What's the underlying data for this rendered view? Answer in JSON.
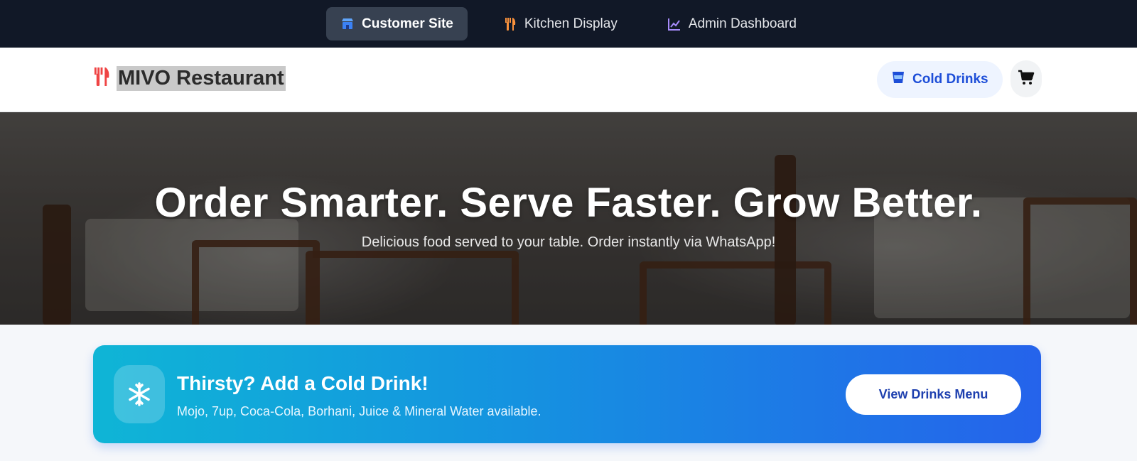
{
  "topbar": {
    "items": [
      {
        "label": "Customer Site",
        "icon": "store-icon",
        "active": true
      },
      {
        "label": "Kitchen Display",
        "icon": "utensils-icon",
        "active": false
      },
      {
        "label": "Admin Dashboard",
        "icon": "chart-line-icon",
        "active": false
      }
    ]
  },
  "header": {
    "brand_icon": "utensils-icon",
    "brand_title": "MIVO Restaurant",
    "drinks_label": "Cold Drinks",
    "drinks_icon": "glass-icon",
    "cart_icon": "cart-icon"
  },
  "hero": {
    "headline": "Order Smarter. Serve Faster. Grow Better.",
    "subtitle": "Delicious food served to your table. Order instantly via WhatsApp!"
  },
  "promo": {
    "icon": "snowflake-icon",
    "title": "Thirsty? Add a Cold Drink!",
    "description": "Mojo, 7up, Coca-Cola, Borhani, Juice & Mineral Water available.",
    "button_label": "View Drinks Menu"
  },
  "colors": {
    "topbar_bg": "#111827",
    "accent_blue": "#1d4ed8",
    "brand_red": "#ef4444",
    "kitchen_orange": "#fb923c",
    "admin_purple": "#a78bfa",
    "promo_start": "#0fb5d6",
    "promo_end": "#2563eb"
  }
}
